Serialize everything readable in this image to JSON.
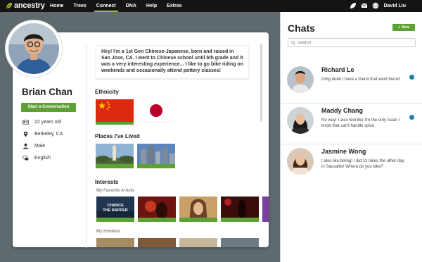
{
  "nav": {
    "brand": "ancestry",
    "items": [
      {
        "label": "Home",
        "active": false
      },
      {
        "label": "Trees",
        "active": false
      },
      {
        "label": "Connect",
        "active": true
      },
      {
        "label": "DNA",
        "active": false
      },
      {
        "label": "Help",
        "active": false
      },
      {
        "label": "Extras",
        "active": false
      }
    ],
    "user_name": "David Liu",
    "accent": "#9cbe30"
  },
  "profile": {
    "name": "Brian Chan",
    "cta_label": "Start a Conversation",
    "facts": [
      {
        "icon": "id-card-icon",
        "text": "22 years old"
      },
      {
        "icon": "location-pin-icon",
        "text": "Berkeley, CA"
      },
      {
        "icon": "person-icon",
        "text": "Male"
      },
      {
        "icon": "speech-bubbles-icon",
        "text": "English"
      }
    ],
    "bio": "Hey! I'm a 1st Gen Chinese-Japanese, born and raised in San Jose, CA. I went to Chinese school until 6th grade and it was a very interesting experience... I like to go bike riding on weekends and occasionally attend pottery classes!",
    "sections": {
      "ethnicity": "Ethnicity",
      "places": "Places I've Lived",
      "interests": "Interests",
      "artists": "My Favorite Artists",
      "hobbies": "My Hobbies"
    },
    "flags": [
      {
        "icon": "china-flag-icon",
        "color": "#de2910"
      },
      {
        "icon": "japan-flag-icon",
        "color": "#bc002d"
      }
    ],
    "artist_tile_text": "CHANCE\nTHE RAPPER"
  },
  "chats": {
    "title": "Chats",
    "new_label": "+ New",
    "search_placeholder": "Search",
    "items": [
      {
        "name": "Richard Le",
        "message": "Omg dude I have a friend that went there!!",
        "unread": true
      },
      {
        "name": "Maddy Chang",
        "message": "No way! I also feel like I'm the only Asian I know that can't handle spice",
        "unread": true
      },
      {
        "name": "Jasmine Wong",
        "message": "I also like biking! I did 13 miles the other day in Sausalito! Where do you bike?",
        "unread": false
      }
    ]
  },
  "colors": {
    "green": "#5fa034",
    "unread_dot": "#1b7fa3",
    "background": "#5f6a6f"
  }
}
